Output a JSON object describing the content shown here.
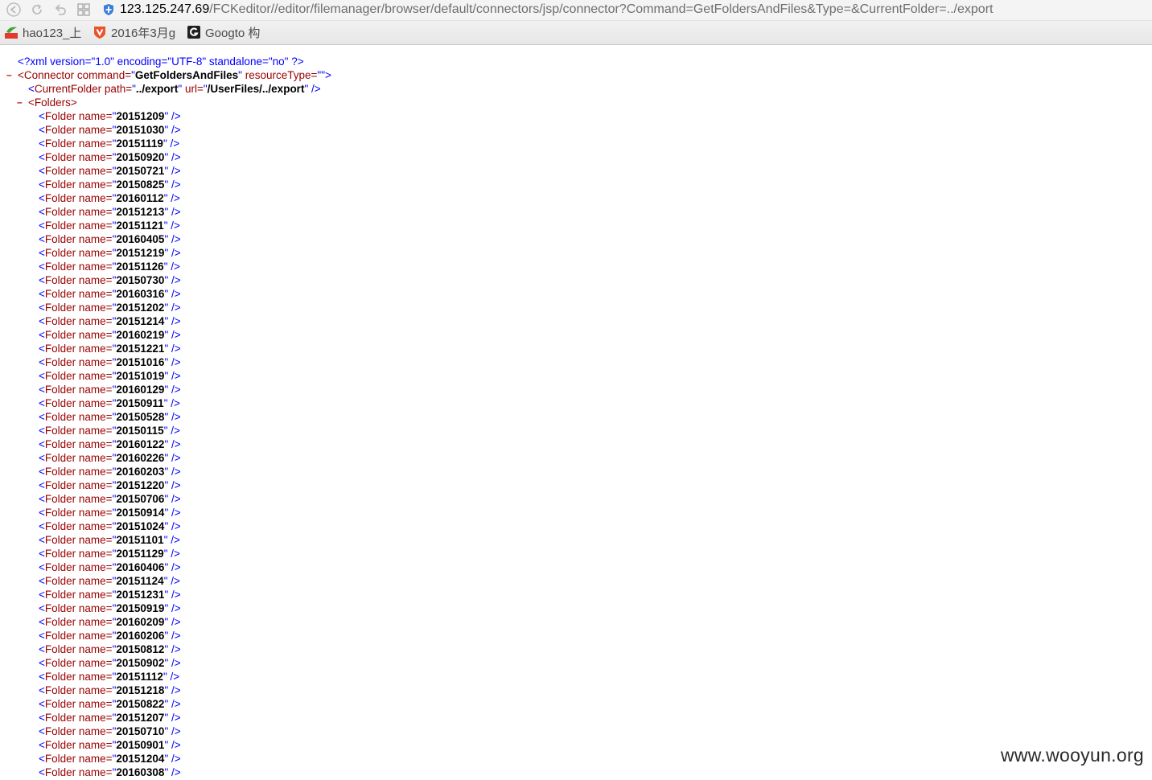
{
  "browser": {
    "nav_icons": [
      "back-arrow-icon",
      "reload-icon",
      "undo-icon",
      "grid-icon"
    ],
    "url_host": "123.125.247.69",
    "url_path": "/FCKeditor//editor/filemanager/browser/default/connectors/jsp/connector?Command=GetFoldersAndFiles&Type=&CurrentFolder=../export",
    "bookmarks": [
      {
        "label": "hao123_上",
        "icon": "hao123-icon"
      },
      {
        "label": "2016年3月g",
        "icon": "shield-v-icon"
      },
      {
        "label": "Googto 构",
        "icon": "g-logo-icon"
      }
    ]
  },
  "xml": {
    "declaration": "<?xml version=\"1.0\" encoding=\"UTF-8\" standalone=\"no\" ?>",
    "collapse_symbol": "–",
    "connector": {
      "tag_open": "<Connector",
      "attr1_name": " command=",
      "attr1_value": "GetFoldersAndFiles",
      "attr2_name": " resourceType=",
      "attr2_value": "",
      "close": ">"
    },
    "current_folder": {
      "tag_open": "<CurrentFolder",
      "path_name": " path=",
      "path_value": "../export",
      "url_name": " url=",
      "url_value": "/UserFiles/../export",
      "close": " />"
    },
    "folders_tag": "<Folders>",
    "folder_tag": "<Folder",
    "folder_attr": " name=",
    "folder_close": " />",
    "folders": [
      "20151209",
      "20151030",
      "20151119",
      "20150920",
      "20150721",
      "20150825",
      "20160112",
      "20151213",
      "20151121",
      "20160405",
      "20151219",
      "20151126",
      "20150730",
      "20160316",
      "20151202",
      "20151214",
      "20160219",
      "20151221",
      "20151016",
      "20151019",
      "20160129",
      "20150911",
      "20150528",
      "20150115",
      "20160122",
      "20160226",
      "20160203",
      "20151220",
      "20150706",
      "20150914",
      "20151024",
      "20151101",
      "20151129",
      "20160406",
      "20151124",
      "20151231",
      "20150919",
      "20160209",
      "20160206",
      "20150812",
      "20150902",
      "20151112",
      "20151218",
      "20150822",
      "20151207",
      "20150710",
      "20150901",
      "20151204",
      "20160308"
    ]
  },
  "watermark": "www.wooyun.org"
}
